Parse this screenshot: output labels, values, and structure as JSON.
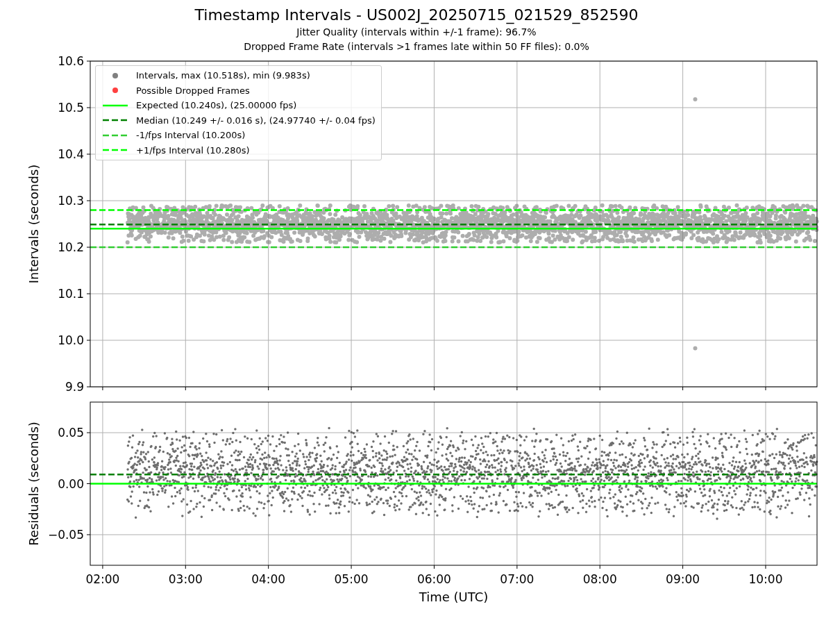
{
  "title": "Timestamp Intervals - US002J_20250715_021529_852590",
  "subtitles": [
    "Jitter Quality (intervals within +/-1 frame): 96.7%",
    "Dropped Frame Rate (intervals >1 frames late within 50 FF files): 0.0%"
  ],
  "intervals_plot": {
    "point_legend": [
      {
        "label": "Intervals, max (10.518s), min (9.983s)",
        "color": "#808080"
      },
      {
        "label": "Possible Dropped Frames",
        "color": "#ff4040"
      }
    ],
    "chart_data": {
      "type": "line",
      "ylabel": "Intervals (seconds)",
      "x": [
        1.85,
        10.62
      ],
      "xlim": [
        1.85,
        10.62
      ],
      "ylim": [
        9.9,
        10.6
      ],
      "grid": true,
      "legend": true,
      "yticks": [
        {
          "value": 9.9,
          "label": "9.9"
        },
        {
          "value": 10.0,
          "label": "10.0"
        },
        {
          "value": 10.1,
          "label": "10.1"
        },
        {
          "value": 10.2,
          "label": "10.2"
        },
        {
          "value": 10.3,
          "label": "10.3"
        },
        {
          "value": 10.4,
          "label": "10.4"
        },
        {
          "value": 10.5,
          "label": "10.5"
        },
        {
          "value": 10.6,
          "label": "10.6"
        }
      ],
      "series": [
        {
          "name": "Expected (10.240s), (25.00000 fps)",
          "color": "#00ff00",
          "line_style": "solid",
          "values": [
            10.24,
            10.24
          ]
        },
        {
          "name": "Median (10.249 +/- 0.016 s), (24.97740 +/- 0.04 fps)",
          "color": "#008000",
          "line_style": "dashed",
          "values": [
            10.249,
            10.249
          ]
        },
        {
          "name": "-1/fps Interval (10.200s)",
          "color": "#32cd32",
          "line_style": "dashed",
          "values": [
            10.2,
            10.2
          ]
        },
        {
          "name": "+1/fps Interval (10.280s)",
          "color": "#00ff00",
          "line_style": "dashed",
          "values": [
            10.28,
            10.28
          ]
        }
      ]
    }
  },
  "residuals_plot": {
    "chart_data": {
      "type": "line",
      "xlabel": "Time (UTC)",
      "ylabel": "Residuals (seconds)",
      "grid": true,
      "x": [
        1.85,
        10.62
      ],
      "xlim": [
        1.85,
        10.62
      ],
      "ylim": [
        -0.08,
        0.08
      ],
      "xticks": [
        {
          "value": 2,
          "label": "02:00"
        },
        {
          "value": 3,
          "label": "03:00"
        },
        {
          "value": 4,
          "label": "04:00"
        },
        {
          "value": 5,
          "label": "05:00"
        },
        {
          "value": 6,
          "label": "06:00"
        },
        {
          "value": 7,
          "label": "07:00"
        },
        {
          "value": 8,
          "label": "08:00"
        },
        {
          "value": 9,
          "label": "09:00"
        },
        {
          "value": 10,
          "label": "10:00"
        }
      ],
      "yticks": [
        {
          "value": -0.05,
          "label": "−0.05"
        },
        {
          "value": 0.0,
          "label": "0.00"
        },
        {
          "value": 0.05,
          "label": "0.05"
        }
      ],
      "series": [
        {
          "color": "#00ff00",
          "line_style": "solid",
          "values": [
            0,
            0
          ]
        },
        {
          "color": "#008000",
          "line_style": "dashed",
          "values": [
            0.009,
            0.009
          ]
        }
      ]
    }
  }
}
